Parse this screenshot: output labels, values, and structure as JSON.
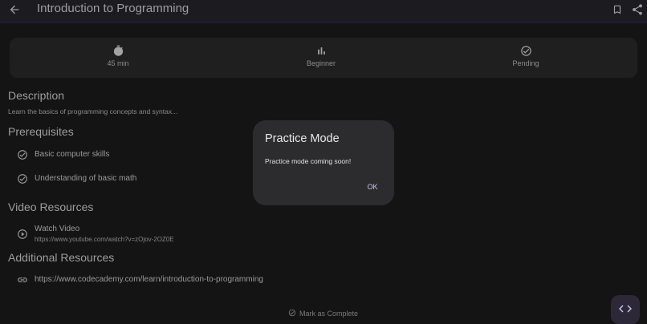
{
  "appbar": {
    "title": "Introduction to Programming",
    "back_icon": "arrow-back-icon",
    "bookmark_icon": "bookmark-icon",
    "share_icon": "share-icon"
  },
  "stats": [
    {
      "icon": "timer-icon",
      "label": "45 min"
    },
    {
      "icon": "bar-chart-icon",
      "label": "Beginner"
    },
    {
      "icon": "check-circle-icon",
      "label": "Pending"
    }
  ],
  "description": {
    "heading": "Description",
    "text": "Learn the basics of programming concepts and syntax..."
  },
  "prerequisites": {
    "heading": "Prerequisites",
    "items": [
      "Basic computer skills",
      "Understanding of basic math"
    ]
  },
  "video_resources": {
    "heading": "Video Resources",
    "items": [
      {
        "title": "Watch Video",
        "url": "https://www.youtube.com/watch?v=zOjov-2OZ0E"
      }
    ]
  },
  "additional_resources": {
    "heading": "Additional Resources",
    "items": [
      "https://www.codecademy.com/learn/introduction-to-programming"
    ]
  },
  "mark_complete_label": "Mark as Complete",
  "fab_icon": "code-icon",
  "dialog": {
    "title": "Practice Mode",
    "body": "Practice mode coming soon!",
    "ok_label": "OK"
  },
  "colors": {
    "background": "#141414",
    "surface": "#1f1f1f",
    "dialog": "#2c2c2f",
    "accent": "#cfc4f2"
  }
}
